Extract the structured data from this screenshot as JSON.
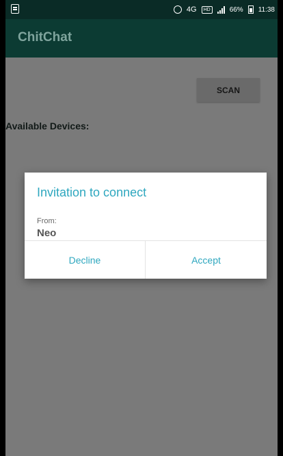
{
  "status_bar": {
    "network": "4G",
    "hd_badge": "HD",
    "battery": "66%",
    "time": "11:38"
  },
  "app_bar": {
    "title": "ChitChat"
  },
  "main": {
    "scan_label": "SCAN",
    "available_devices_label": "Available Devices:"
  },
  "dialog": {
    "title": "Invitation to connect",
    "from_label": "From:",
    "from_value": "Neo",
    "decline_label": "Decline",
    "accept_label": "Accept"
  },
  "colors": {
    "app_bar": "#0c3b33",
    "accent": "#2ea7bf",
    "scrim": "#7a7a7a"
  }
}
